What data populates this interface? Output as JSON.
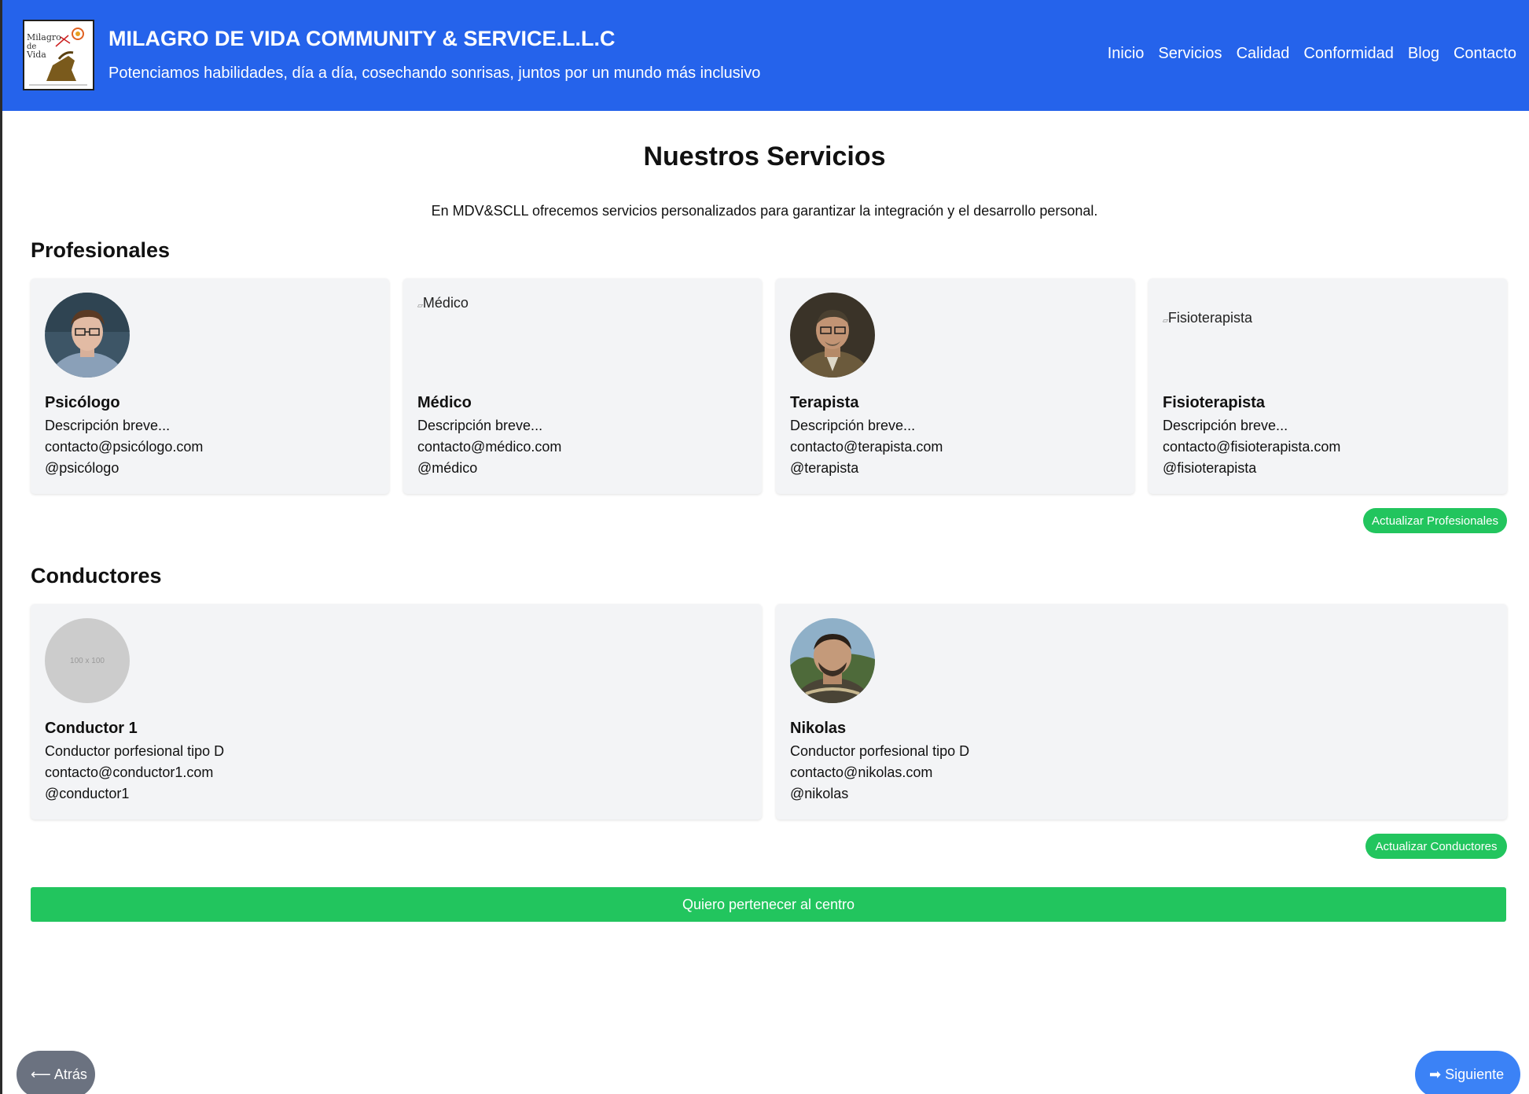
{
  "header": {
    "title": "MILAGRO DE VIDA COMMUNITY & SERVICE.L.L.C",
    "subtitle": "Potenciamos habilidades, día a día, cosechando sonrisas, juntos por un mundo más inclusivo",
    "logo_text": [
      "Milagro",
      "de",
      "Vida"
    ],
    "nav": [
      "Inicio",
      "Servicios",
      "Calidad",
      "Conformidad",
      "Blog",
      "Contacto"
    ]
  },
  "main": {
    "title": "Nuestros Servicios",
    "description": "En MDV&SCLL ofrecemos servicios personalizados para garantizar la integración y el desarrollo personal."
  },
  "profesionales": {
    "title": "Profesionales",
    "cards": [
      {
        "name": "Psicólogo",
        "desc": "Descripción breve...",
        "email": "contacto@psicólogo.com",
        "handle": "@psicólogo",
        "image": "photo",
        "alt": ""
      },
      {
        "name": "Médico",
        "desc": "Descripción breve...",
        "email": "contacto@médico.com",
        "handle": "@médico",
        "image": "broken",
        "alt": "Médico"
      },
      {
        "name": "Terapista",
        "desc": "Descripción breve...",
        "email": "contacto@terapista.com",
        "handle": "@terapista",
        "image": "photo",
        "alt": ""
      },
      {
        "name": "Fisioterapista",
        "desc": "Descripción breve...",
        "email": "contacto@fisioterapista.com",
        "handle": "@fisioterapista",
        "image": "broken",
        "alt": "Fisioterapista"
      }
    ],
    "update_label": "Actualizar Profesionales"
  },
  "conductores": {
    "title": "Conductores",
    "cards": [
      {
        "name": "Conductor 1",
        "desc": "Conductor porfesional tipo D",
        "email": "contacto@conductor1.com",
        "handle": "@conductor1",
        "image": "placeholder",
        "alt": "100 x 100"
      },
      {
        "name": "Nikolas",
        "desc": "Conductor porfesional tipo D",
        "email": "contacto@nikolas.com",
        "handle": "@nikolas",
        "image": "photo",
        "alt": ""
      }
    ],
    "update_label": "Actualizar Conductores"
  },
  "join_label": "Quiero pertenecer al centro",
  "back_label": "⟵ Atrás",
  "next_label": "➡ Siguiente",
  "colors": {
    "header": "#2563eb",
    "green": "#22c55e",
    "card": "#f3f4f6",
    "back": "#6b7280",
    "next": "#3b82f6"
  }
}
